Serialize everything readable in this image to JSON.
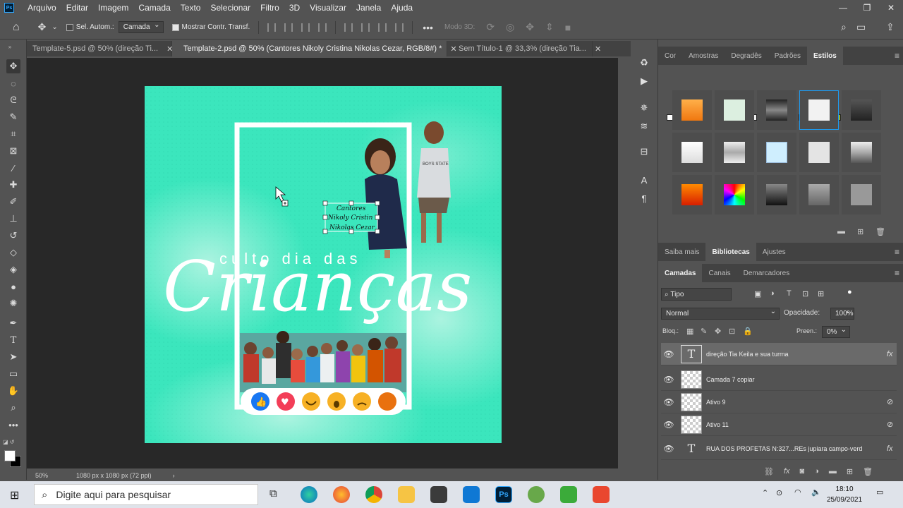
{
  "menubar": {
    "logo": "Ps",
    "items": [
      "Arquivo",
      "Editar",
      "Imagem",
      "Camada",
      "Texto",
      "Selecionar",
      "Filtro",
      "3D",
      "Visualizar",
      "Janela",
      "Ajuda"
    ]
  },
  "options": {
    "auto_select_label": "Sel. Autom.:",
    "auto_select_value": "Camada",
    "show_transform_label": "Mostrar Contr. Transf.",
    "mode3d_label": "Modo 3D:"
  },
  "tabs": [
    {
      "label": "Template-5.psd @ 50% (direção Ti...",
      "active": false
    },
    {
      "label": "Template-2.psd @ 50% (Cantores Nikoly Cristina Nikolas Cezar, RGB/8#) *",
      "active": true
    },
    {
      "label": "Sem Título-1 @ 33,3% (direção Tia...",
      "active": false
    }
  ],
  "canvas": {
    "title_line1": "culto dia das",
    "title_script": "Crianças",
    "text_box": [
      "Cantores",
      "Nikoly Cristin",
      "Nikolas Cezar"
    ],
    "shirt_text": "BOYS STATE",
    "reactions": [
      "like",
      "love",
      "haha",
      "wow",
      "sad",
      "angry"
    ],
    "bg_color": "#3be6bd"
  },
  "status": {
    "zoom": "50%",
    "doc_info": "1080 px x 1080 px (72 ppi)"
  },
  "styles_panel": {
    "tabs": [
      "Cor",
      "Amostras",
      "Degradês",
      "Padrões",
      "Estilos"
    ],
    "active_tab": "Estilos"
  },
  "library_panel": {
    "tabs": [
      "Saiba mais",
      "Bibliotecas",
      "Ajustes"
    ],
    "active_tab": "Bibliotecas"
  },
  "layers_panel": {
    "tabs": [
      "Camadas",
      "Canais",
      "Demarcadores"
    ],
    "active_tab": "Camadas",
    "filter_value": "Tipo",
    "blend_mode": "Normal",
    "opacity_label": "Opacidade:",
    "opacity_value": "100%",
    "lock_label": "Bloq.:",
    "fill_label": "Preen.:",
    "fill_value": "0%",
    "layers": [
      {
        "name": "direção Tia Keila e sua turma",
        "kind": "text",
        "fx": true,
        "selected": true
      },
      {
        "name": "Camada 7 copiar",
        "kind": "pixel",
        "fx": false,
        "selected": false
      },
      {
        "name": "Ativo 9",
        "kind": "smart",
        "fx": false,
        "selected": false
      },
      {
        "name": "Ativo 11",
        "kind": "smart",
        "fx": false,
        "selected": false
      },
      {
        "name": "RUA DOS PROFETAS N:327...REs jupiara campo-verd",
        "kind": "text",
        "fx": true,
        "selected": false
      }
    ]
  },
  "taskbar": {
    "search_placeholder": "Digite aqui para pesquisar",
    "time": "18:10",
    "date": "25/09/2021"
  }
}
